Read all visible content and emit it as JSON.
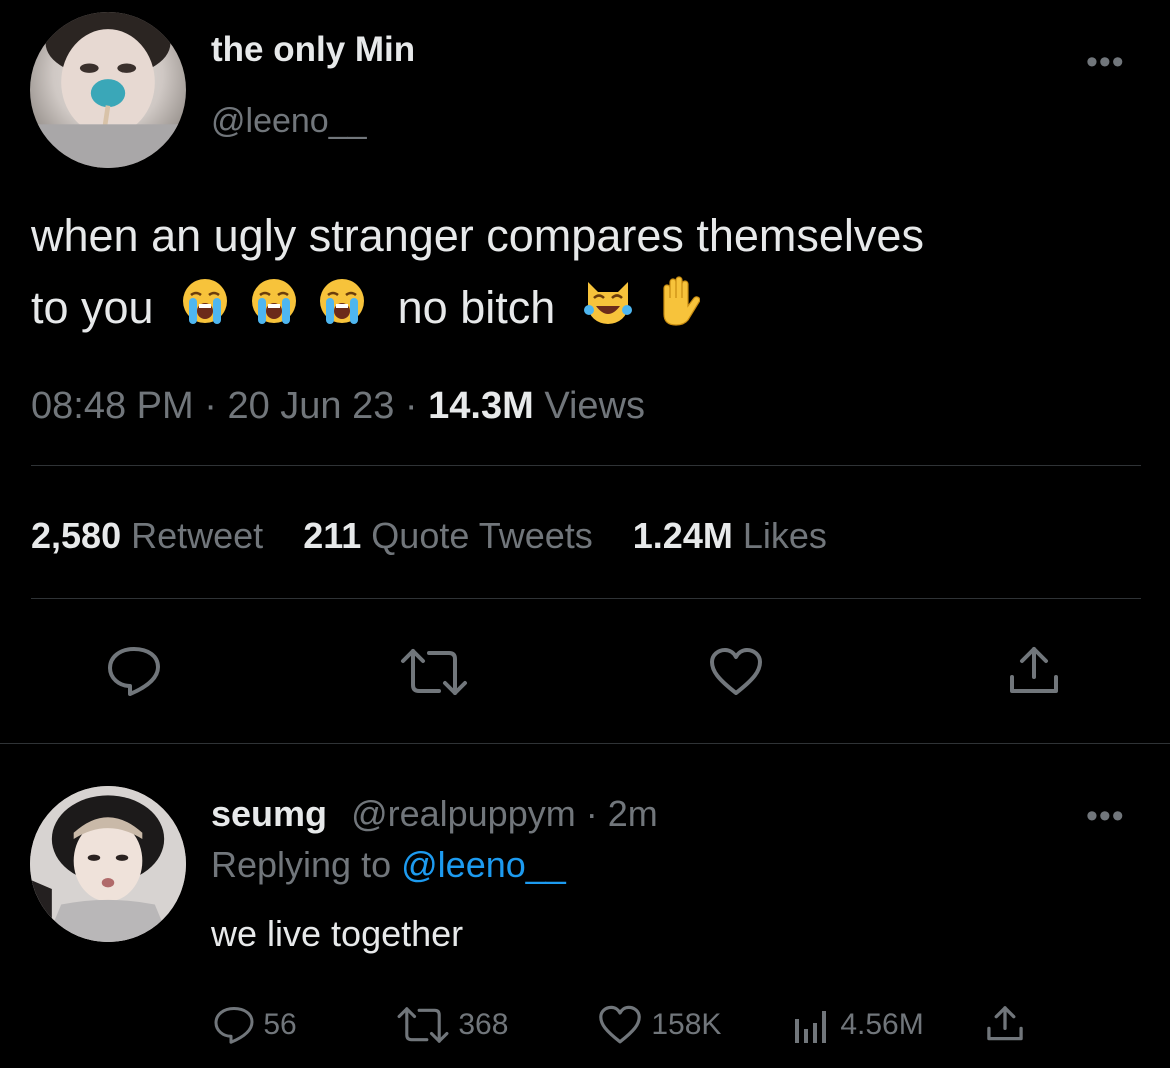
{
  "tweet": {
    "display_name": "the only Min",
    "handle": "@leeno__",
    "text_line1": "when an ugly stranger compares themselves",
    "text_line2_a": "to you",
    "text_line2_b": "no bitch",
    "emojis": [
      "loudly-crying-face",
      "loudly-crying-face",
      "loudly-crying-face",
      "cat-with-tears-of-joy",
      "raised-hand"
    ],
    "time": "08:48 PM",
    "date": "20 Jun 23",
    "views_count": "14.3M",
    "views_label": "Views",
    "retweets_count": "2,580",
    "retweets_label": "Retweet",
    "quotes_count": "211",
    "quotes_label": "Quote Tweets",
    "likes_count": "1.24M",
    "likes_label": "Likes",
    "more_label": "•••",
    "separator": "·"
  },
  "reply": {
    "display_name": "seumg",
    "handle": "@realpuppym",
    "time_ago": "2m",
    "replying_prefix": "Replying to",
    "replying_handle": "@leeno__",
    "text": "we live together",
    "replies": "56",
    "retweets": "368",
    "likes": "158K",
    "views": "4.56M",
    "more_label": "•••",
    "separator": "·"
  },
  "colors": {
    "background": "#000000",
    "text": "#e7e9ea",
    "muted": "#71767b",
    "link": "#1d9bf0",
    "divider": "#2f3336"
  },
  "icons": [
    "reply-icon",
    "retweet-icon",
    "like-icon",
    "share-icon",
    "views-icon",
    "more-icon"
  ]
}
